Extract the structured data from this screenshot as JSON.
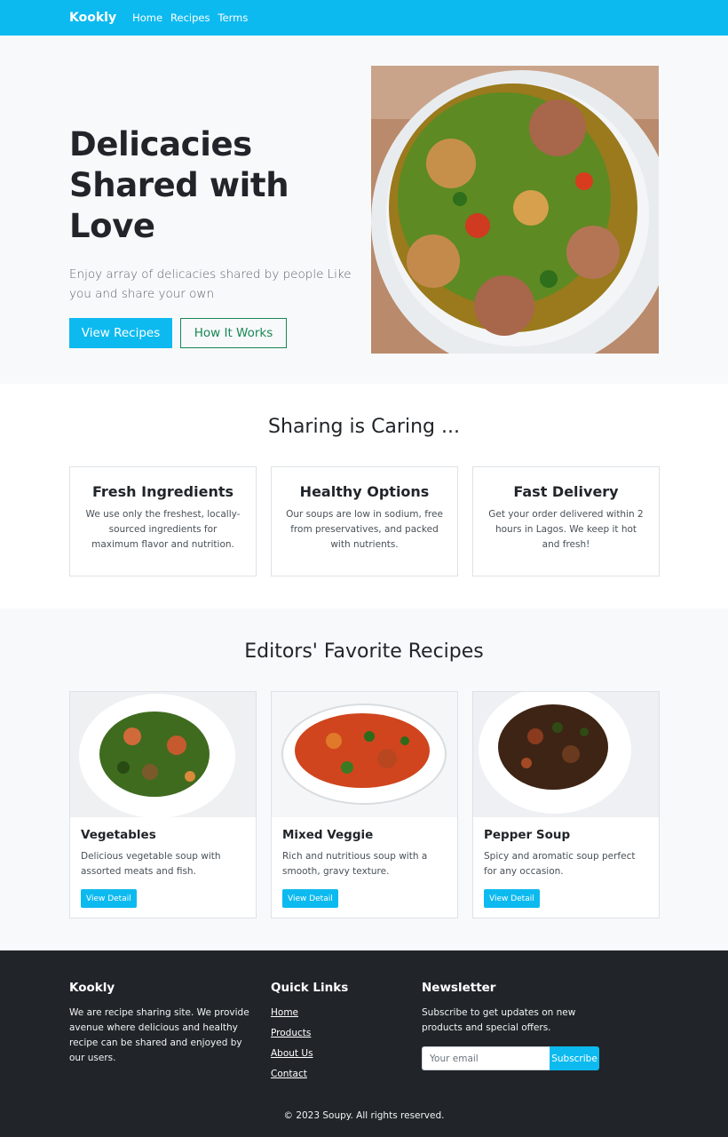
{
  "nav": {
    "brand": "Kookly",
    "links": [
      "Home",
      "Recipes",
      "Terms"
    ]
  },
  "hero": {
    "title": "Delicacies Shared with Love",
    "subtitle": "Enjoy array of delicacies shared by people Like you and share your own",
    "primary_button": "View Recipes",
    "secondary_button": "How It Works"
  },
  "features": {
    "heading": "Sharing is Caring ...",
    "items": [
      {
        "title": "Fresh Ingredients",
        "text": "We use only the freshest, locally-sourced ingredients for maximum flavor and nutrition."
      },
      {
        "title": "Healthy Options",
        "text": "Our soups are low in sodium, free from preservatives, and packed with nutrients."
      },
      {
        "title": "Fast Delivery",
        "text": "Get your order delivered within 2 hours in Lagos. We keep it hot and fresh!"
      }
    ]
  },
  "recipes": {
    "heading": "Editors' Favorite Recipes",
    "items": [
      {
        "title": "Vegetables",
        "text": "Delicious vegetable soup with assorted meats and fish.",
        "button": "View Detail"
      },
      {
        "title": "Mixed Veggie",
        "text": "Rich and nutritious soup with a smooth, gravy texture.",
        "button": "View Detail"
      },
      {
        "title": "Pepper Soup",
        "text": "Spicy and aromatic soup perfect for any occasion.",
        "button": "View Detail"
      }
    ]
  },
  "footer": {
    "about": {
      "title": "Kookly",
      "text": "We are recipe sharing site. We provide avenue where delicious and healthy recipe can be shared and enjoyed by our users."
    },
    "quick_links": {
      "title": "Quick Links",
      "links": [
        "Home",
        "Products",
        "About Us",
        "Contact"
      ]
    },
    "newsletter": {
      "title": "Newsletter",
      "text": "Subscribe to get updates on new products and special offers.",
      "placeholder": "Your email",
      "button": "Subscribe"
    },
    "copyright": "© 2023 Soupy. All rights reserved."
  },
  "colors": {
    "accent": "#0dbaf0",
    "success": "#198754",
    "footer_bg": "#212529",
    "section_bg": "#f8f9fb"
  }
}
